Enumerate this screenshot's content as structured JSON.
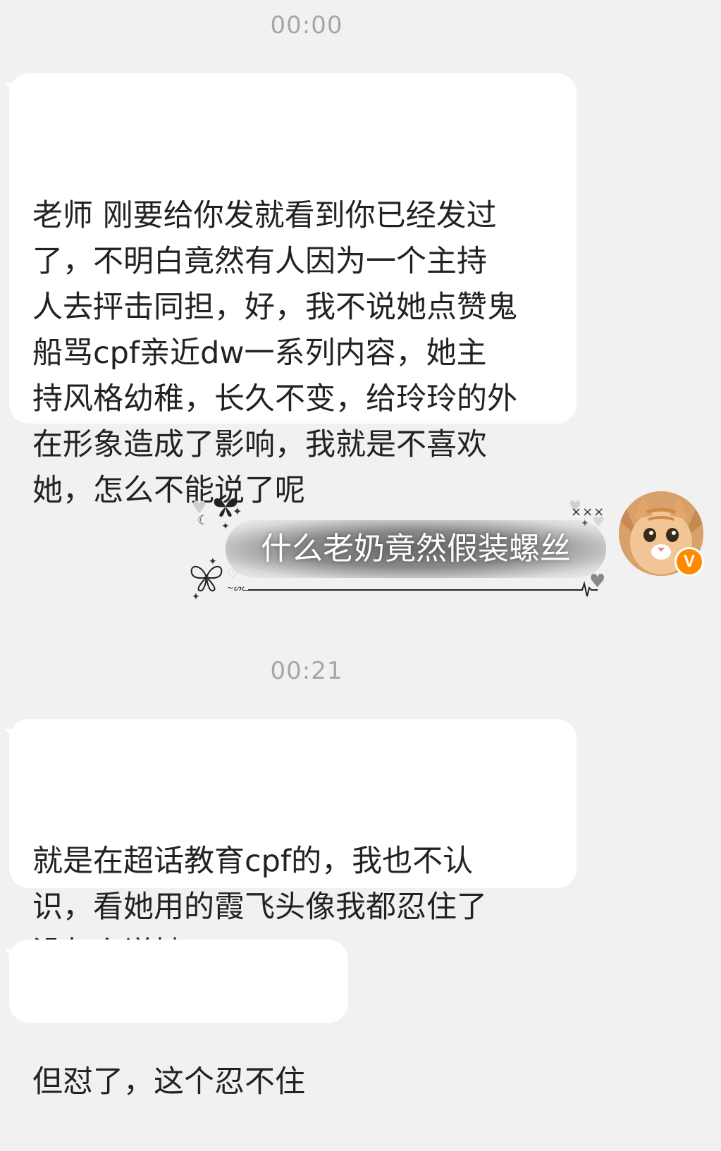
{
  "timestamps": [
    "00:00",
    "00:21"
  ],
  "messages": [
    {
      "direction": "incoming",
      "text": "老师 刚要给你发就看到你已经发过\n了，不明白竟然有人因为一个主持\n人去抨击同担，好，我不说她点赞鬼\n船骂cpf亲近dw一系列内容，她主\n持风格幼稚，长久不变，给玲玲的外\n在形象造成了影响，我就是不喜欢\n她，怎么不能说了呢"
    },
    {
      "direction": "outgoing",
      "text": "什么老奶竟然假装螺丝"
    },
    {
      "direction": "incoming",
      "text": "就是在超话教育cpf的，我也不认\n识，看她用的霞飞头像我都忍住了\n没怎么说她"
    },
    {
      "direction": "incoming",
      "text": "但怼了，这个忍不住"
    }
  ],
  "avatar": {
    "icon": "orange-cat-avatar",
    "badge": "V",
    "badge_color": "#ff8a00"
  },
  "colors": {
    "background": "#f1f1f1",
    "bubble_incoming": "#ffffff",
    "timestamp": "#a6a6a6"
  }
}
